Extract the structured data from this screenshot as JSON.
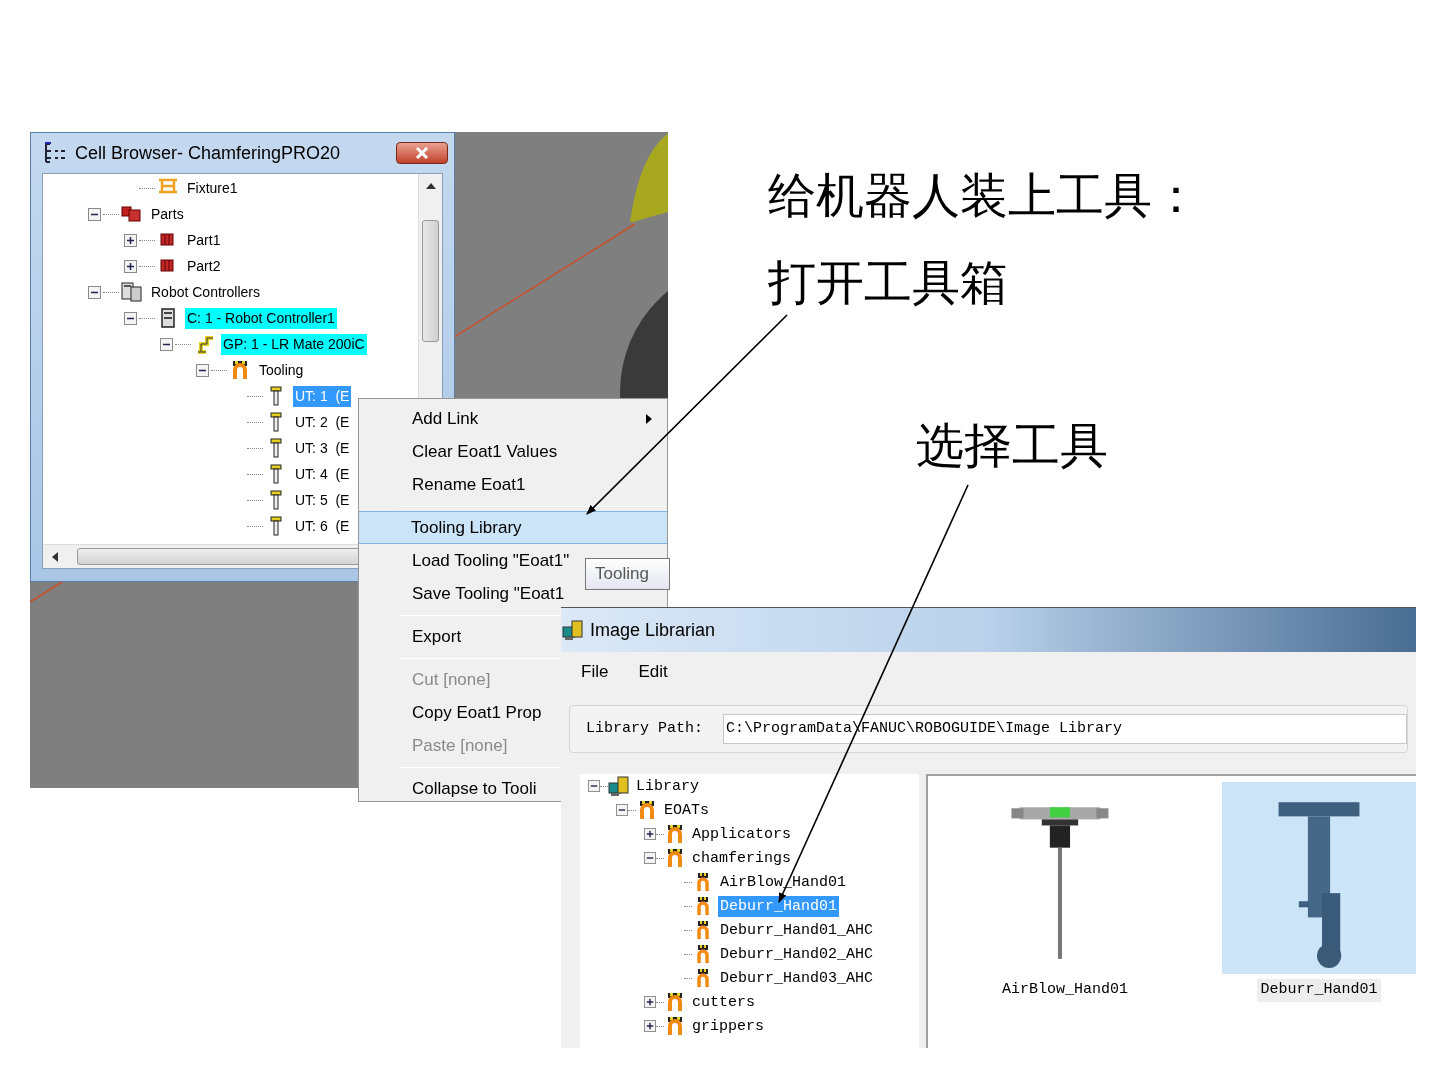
{
  "slide": {
    "heading": "给机器人装上工具：",
    "step_1": "打开工具箱",
    "step_2": "选择工具"
  },
  "cell_browser": {
    "title": "Cell Browser- ChamferingPRO20",
    "tree": {
      "continued": [
        {
          "label": "Fixture1",
          "kind": "fixture",
          "selected": false,
          "highlighted": false
        }
      ],
      "items": [
        {
          "label": "Parts",
          "kind": "parts",
          "expanded": true,
          "selected": false,
          "highlighted": false,
          "children": [
            {
              "label": "Part1",
              "kind": "part",
              "expanded": false,
              "selected": false,
              "highlighted": false
            },
            {
              "label": "Part2",
              "kind": "part",
              "expanded": false,
              "selected": false,
              "highlighted": false
            }
          ]
        },
        {
          "label": "Robot Controllers",
          "kind": "controllers",
          "expanded": true,
          "selected": false,
          "highlighted": false,
          "children": [
            {
              "label": "C: 1 - Robot Controller1",
              "kind": "controller",
              "expanded": true,
              "selected": false,
              "highlighted": true,
              "children": [
                {
                  "label": "GP: 1 - LR Mate 200iC",
                  "kind": "robot",
                  "expanded": true,
                  "selected": false,
                  "highlighted": true,
                  "children": [
                    {
                      "label": "Tooling",
                      "kind": "tooling",
                      "expanded": true,
                      "selected": false,
                      "highlighted": false,
                      "children": [
                        {
                          "label": "UT: 1  (E",
                          "kind": "tool",
                          "selected": true,
                          "highlighted": false
                        },
                        {
                          "label": "UT: 2  (E",
                          "kind": "tool",
                          "selected": false,
                          "highlighted": false
                        },
                        {
                          "label": "UT: 3  (E",
                          "kind": "tool",
                          "selected": false,
                          "highlighted": false
                        },
                        {
                          "label": "UT: 4  (E",
                          "kind": "tool",
                          "selected": false,
                          "highlighted": false
                        },
                        {
                          "label": "UT: 5  (E",
                          "kind": "tool",
                          "selected": false,
                          "highlighted": false
                        },
                        {
                          "label": "UT: 6  (E",
                          "kind": "tool",
                          "selected": false,
                          "highlighted": false
                        }
                      ]
                    }
                  ]
                }
              ]
            }
          ]
        }
      ]
    }
  },
  "context_menu": {
    "items": [
      {
        "kind": "item",
        "label": "Add Link",
        "submenu": true,
        "disabled": false,
        "selected": false
      },
      {
        "kind": "item",
        "label": "Clear Eoat1 Values",
        "submenu": false,
        "disabled": false,
        "selected": false
      },
      {
        "kind": "item",
        "label": "Rename Eoat1",
        "submenu": false,
        "disabled": false,
        "selected": false
      },
      {
        "kind": "separator"
      },
      {
        "kind": "item",
        "label": "Tooling Library",
        "submenu": false,
        "disabled": false,
        "selected": true
      },
      {
        "kind": "item",
        "label": "Load Tooling \"Eoat1\"",
        "submenu": false,
        "disabled": false,
        "selected": false
      },
      {
        "kind": "item",
        "label": "Save Tooling \"Eoat1",
        "submenu": false,
        "disabled": false,
        "selected": false
      },
      {
        "kind": "separator"
      },
      {
        "kind": "item",
        "label": "Export",
        "submenu": false,
        "disabled": false,
        "selected": false
      },
      {
        "kind": "separator"
      },
      {
        "kind": "item",
        "label": "Cut [none]",
        "submenu": false,
        "disabled": true,
        "selected": false
      },
      {
        "kind": "item",
        "label": "Copy Eoat1 Prop",
        "submenu": false,
        "disabled": false,
        "selected": false
      },
      {
        "kind": "item",
        "label": "Paste [none]",
        "submenu": false,
        "disabled": true,
        "selected": false
      },
      {
        "kind": "separator"
      },
      {
        "kind": "item",
        "label": "Collapse to Tooli",
        "submenu": false,
        "disabled": false,
        "selected": false
      }
    ]
  },
  "tooltip": "Tooling",
  "image_librarian": {
    "title": "Image Librarian",
    "menu": [
      "File",
      "Edit"
    ],
    "path_label": "Library Path:",
    "path": "C:\\ProgramData\\FANUC\\ROBOGUIDE\\Image Library",
    "tree": [
      {
        "label": "Library",
        "kind": "library",
        "expanded": true,
        "selected": false,
        "children": [
          {
            "label": "EOATs",
            "kind": "tooling",
            "expanded": true,
            "selected": false,
            "children": [
              {
                "label": "Applicators",
                "kind": "tooling",
                "expanded": false,
                "selected": false
              },
              {
                "label": "chamferings",
                "kind": "tooling",
                "expanded": true,
                "selected": false,
                "children": [
                  {
                    "label": "AirBlow_Hand01",
                    "kind": "gripper",
                    "selected": false
                  },
                  {
                    "label": "Deburr_Hand01",
                    "kind": "gripper",
                    "selected": true
                  },
                  {
                    "label": "Deburr_Hand01_AHC",
                    "kind": "gripper",
                    "selected": false
                  },
                  {
                    "label": "Deburr_Hand02_AHC",
                    "kind": "gripper",
                    "selected": false
                  },
                  {
                    "label": "Deburr_Hand03_AHC",
                    "kind": "gripper",
                    "selected": false
                  }
                ]
              },
              {
                "label": "cutters",
                "kind": "tooling",
                "expanded": false,
                "selected": false
              },
              {
                "label": "grippers",
                "kind": "tooling",
                "expanded": false,
                "selected": false
              }
            ]
          }
        ]
      }
    ],
    "thumbnails": [
      {
        "label": "AirBlow_Hand01",
        "kind": "airblow",
        "selected": false
      },
      {
        "label": "Deburr_Hand01",
        "kind": "deburr",
        "selected": true
      }
    ]
  }
}
